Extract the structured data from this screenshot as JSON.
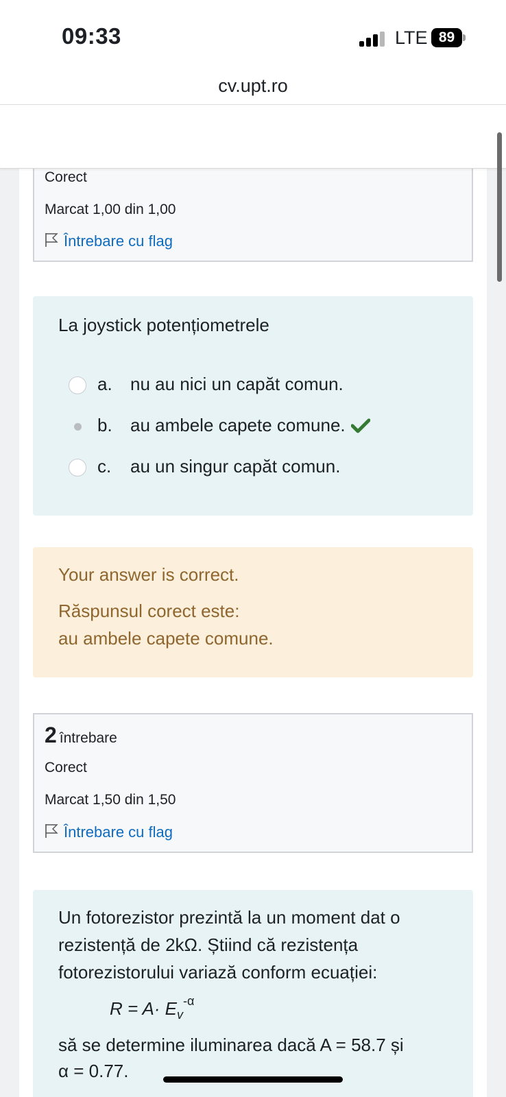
{
  "status_bar": {
    "time": "09:33",
    "network": "LTE",
    "battery": "89"
  },
  "browser": {
    "url": "cv.upt.ro"
  },
  "question1": {
    "state": "Corect",
    "mark": "Marcat 1,00 din 1,00",
    "flag_label": "Întrebare cu flag",
    "text": "La joystick potențiometrele",
    "options": [
      {
        "letter": "a.",
        "text": "nu au nici un capăt comun."
      },
      {
        "letter": "b.",
        "text": "au ambele capete comune."
      },
      {
        "letter": "c.",
        "text": "au un singur capăt comun."
      }
    ],
    "selected_option": "b.",
    "feedback": {
      "general": "Your answer is correct.",
      "right_answer_label": "Răspunsul corect este:",
      "right_answer": "au ambele capete comune."
    }
  },
  "question2": {
    "number": "2",
    "number_word": "întrebare",
    "state": "Corect",
    "mark": "Marcat 1,50 din 1,50",
    "flag_label": "Întrebare cu flag",
    "text_lines": [
      "Un fotorezistor prezintă la un moment dat o",
      "rezistență de 2kΩ. Știind că rezistența",
      "fotorezistorului variază conform ecuației:"
    ],
    "formula": {
      "lhs": "R = A· E",
      "subscript": "v",
      "superscript": "-α"
    },
    "text_after_lines": [
      "să se determine iluminarea dacă A = 58.7 și",
      "α = 0.77."
    ]
  },
  "colors": {
    "link": "#0f6cbf",
    "correct_check": "#357a32",
    "feedback_text": "#8e662e",
    "feedback_bg": "#fcefdc",
    "question_bg": "#e7f3f5"
  }
}
